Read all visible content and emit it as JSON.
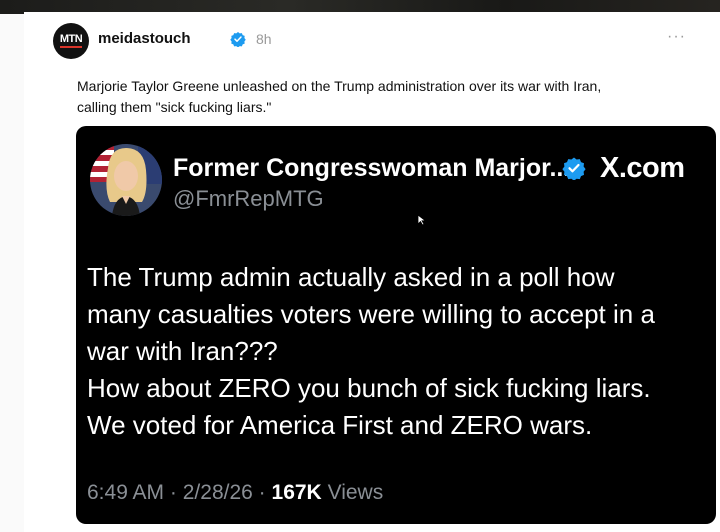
{
  "post": {
    "account_logo_text": "MTN",
    "username": "meidastouch",
    "time_ago": "8h",
    "more_label": "···",
    "caption_line1": "Marjorie Taylor Greene unleashed on the Trump administration over its war with Iran,",
    "caption_line2": "calling them \"sick fucking liars.\""
  },
  "embed": {
    "display_name": "Former Congresswoman Marjor...",
    "handle": "@FmrRepMTG",
    "source": "X.com",
    "lines": [
      "The Trump admin actually asked in a poll how",
      "many casualties voters were willing to accept in a",
      "war with Iran???",
      "How about ZERO you bunch of sick fucking liars.",
      "We voted for America First and ZERO wars."
    ],
    "time": "6:49 AM",
    "separator": "·",
    "date": "2/28/26",
    "views_count": "167K",
    "views_label": "Views"
  },
  "colors": {
    "verified": "#1d9bf0",
    "embed_bg": "#000000",
    "muted": "#8a8f95"
  },
  "icons": [
    "verified-badge-icon",
    "more-options-icon",
    "cursor-icon"
  ]
}
